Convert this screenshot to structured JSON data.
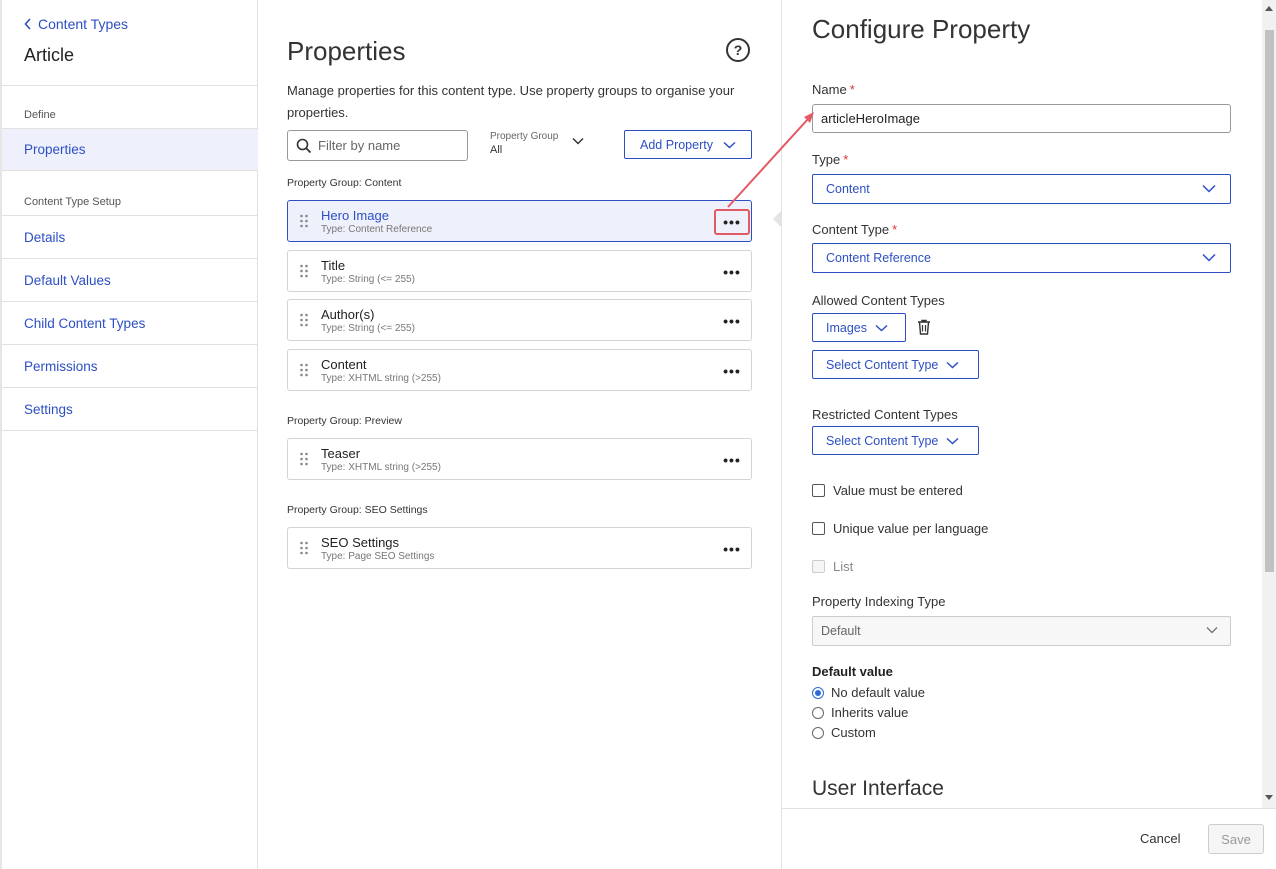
{
  "sidebar": {
    "back_label": "Content Types",
    "title": "Article",
    "define_section": "Define",
    "define_items": [
      {
        "label": "Properties"
      }
    ],
    "setup_section": "Content Type Setup",
    "setup_items": [
      {
        "label": "Details"
      },
      {
        "label": "Default Values"
      },
      {
        "label": "Child Content Types"
      },
      {
        "label": "Permissions"
      },
      {
        "label": "Settings"
      }
    ]
  },
  "main": {
    "title": "Properties",
    "help_glyph": "?",
    "description": "Manage properties for this content type. Use property groups to organise your properties.",
    "filter_placeholder": "Filter by name",
    "property_group_label": "Property Group",
    "property_group_value": "All",
    "add_property_label": "Add Property",
    "more_glyph": "•••",
    "groups": [
      {
        "label": "Property Group: Content",
        "items": [
          {
            "name": "Hero Image",
            "type": "Type: Content Reference"
          },
          {
            "name": "Title",
            "type": "Type: String (<= 255)"
          },
          {
            "name": "Author(s)",
            "type": "Type: String (<= 255)"
          },
          {
            "name": "Content",
            "type": "Type: XHTML string (>255)"
          }
        ]
      },
      {
        "label": "Property Group: Preview",
        "items": [
          {
            "name": "Teaser",
            "type": "Type: XHTML string (>255)"
          }
        ]
      },
      {
        "label": "Property Group: SEO Settings",
        "items": [
          {
            "name": "SEO Settings",
            "type": "Type: Page SEO Settings"
          }
        ]
      }
    ]
  },
  "panel": {
    "title": "Configure Property",
    "required_mark": "*",
    "name_label": "Name",
    "name_value": "articleHeroImage",
    "type_label": "Type",
    "type_value": "Content",
    "content_type_label": "Content Type",
    "content_type_value": "Content Reference",
    "allowed_label": "Allowed Content Types",
    "allowed_value": "Images",
    "select_content_type": "Select Content Type",
    "restricted_label": "Restricted Content Types",
    "value_required_label": "Value must be entered",
    "unique_label": "Unique value per language",
    "list_label": "List",
    "indexing_label": "Property Indexing Type",
    "indexing_value": "Default",
    "default_value_label": "Default value",
    "radio_options": [
      "No default value",
      "Inherits value",
      "Custom"
    ],
    "ui_section_title": "User Interface",
    "cancel_label": "Cancel",
    "save_label": "Save"
  },
  "colors": {
    "accent": "#2c4fc4",
    "highlight": "#e45a64",
    "selected_bg": "#eef1fb"
  }
}
